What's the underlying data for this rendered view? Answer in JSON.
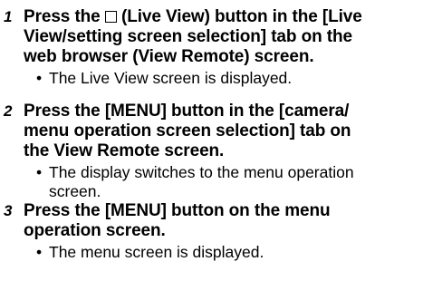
{
  "steps": [
    {
      "number": "1",
      "title_line1_before": "Press the ",
      "title_line1_after": " (Live View) button in the [Live",
      "title_line2": "View/setting screen selection] tab on the",
      "title_line3": "web browser (View Remote) screen.",
      "icon": "live-view-square-icon",
      "bullet_marker": "•",
      "bullet_line1": "The Live View screen is displayed."
    },
    {
      "number": "2",
      "title_line1": "Press the [MENU] button in the [camera/",
      "title_line2": "menu operation screen selection] tab on",
      "title_line3": "the View Remote screen.",
      "bullet_marker": "•",
      "bullet_line1": "The display switches to the menu operation",
      "bullet_line2": "screen."
    },
    {
      "number": "3",
      "title_line1": "Press the [MENU] button on the menu",
      "title_line2": "operation screen.",
      "bullet_marker": "•",
      "bullet_line1": "The menu screen is displayed."
    }
  ]
}
